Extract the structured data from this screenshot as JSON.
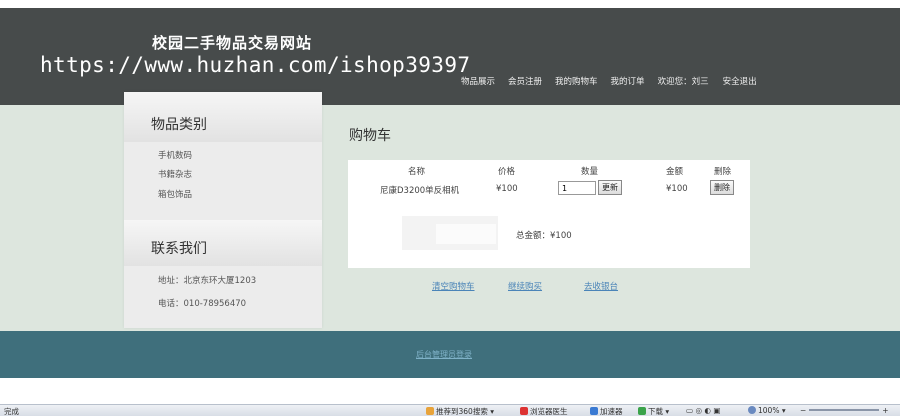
{
  "header": {
    "title": "校园二手物品交易网站",
    "watermark": "https://www.huzhan.com/ishop39397",
    "nav": [
      "物品展示",
      "会员注册",
      "我的购物车",
      "我的订单",
      "欢迎您：刘三",
      "安全退出"
    ]
  },
  "sidebar": {
    "category_heading": "物品类别",
    "categories": [
      "手机数码",
      "书籍杂志",
      "箱包饰品"
    ],
    "contact_heading": "联系我们",
    "contact": [
      "地址：北京东环大厦1203",
      "电话：010-78956470"
    ]
  },
  "cart": {
    "title": "购物车",
    "headers": [
      "名称",
      "价格",
      "数量",
      "金额",
      "删除"
    ],
    "rows": [
      {
        "name": "尼康D3200单反相机",
        "price": "¥100",
        "qty": "1",
        "update_label": "更新",
        "amount": "¥100",
        "delete_label": "删除"
      }
    ],
    "total": "总金额：¥100",
    "links": [
      "清空购物车",
      "继续购买",
      "去收银台"
    ]
  },
  "footer": {
    "link": "后台管理员登录"
  },
  "statusbar": {
    "left": "完成",
    "items": [
      "推荐到360搜索",
      "浏览器医生",
      "加速器",
      "下载",
      "100%"
    ]
  },
  "colors": {
    "header_bg": "#474b4b",
    "body_bg": "#dde6de",
    "footer_bg": "#3f6f7c",
    "link": "#4a84b8"
  }
}
